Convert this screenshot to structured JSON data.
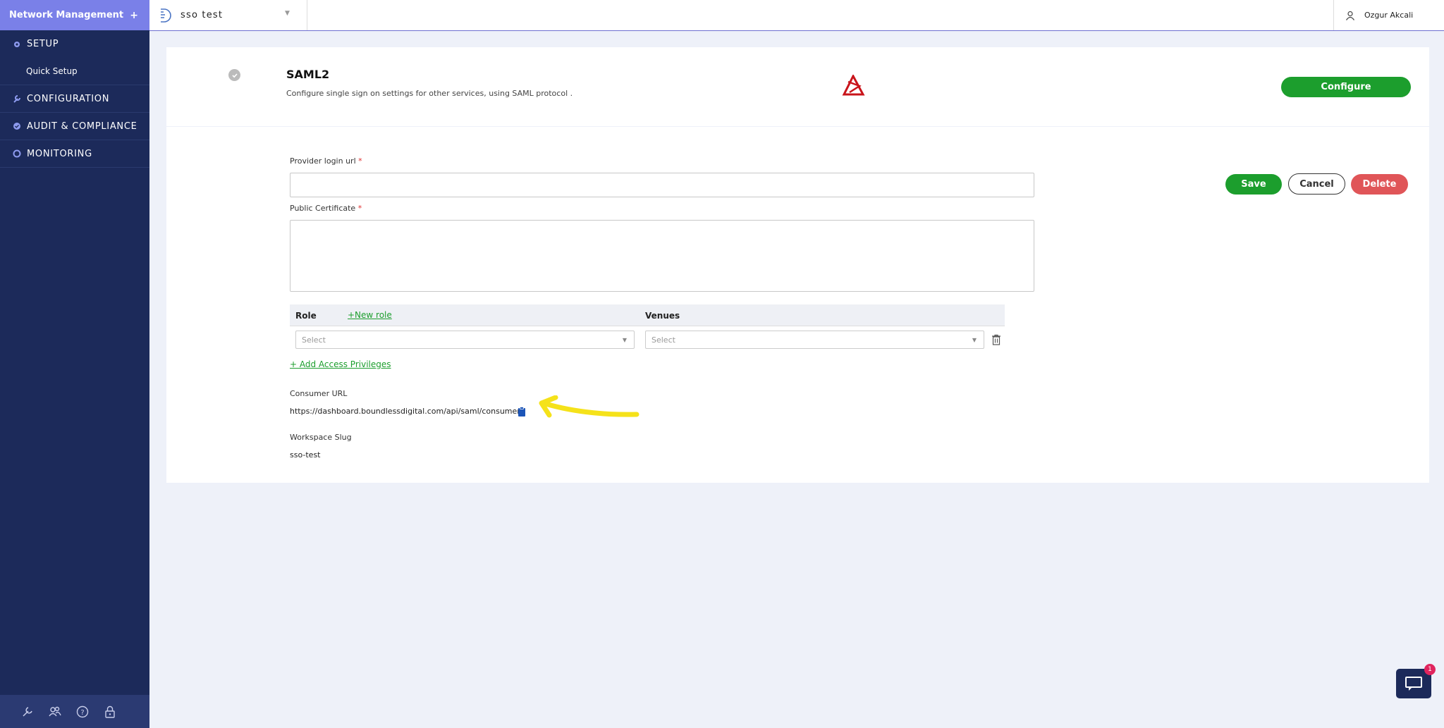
{
  "sidebar": {
    "title": "Network Management",
    "add_label": "+",
    "items": [
      {
        "label": "SETUP"
      },
      {
        "label": "Quick Setup"
      },
      {
        "label": "CONFIGURATION"
      },
      {
        "label": "AUDIT & COMPLIANCE"
      },
      {
        "label": "MONITORING"
      }
    ],
    "footer_icons": [
      "wrench-icon",
      "users-icon",
      "help-icon",
      "lock-icon"
    ]
  },
  "topbar": {
    "workspace_name": "sso test",
    "user_name": "Ozgur Akcali"
  },
  "saml": {
    "title": "SAML2",
    "description": "Configure single sign on settings for other services, using SAML protocol .",
    "configure_label": "Configure"
  },
  "form": {
    "provider_login_url_label": "Provider login url",
    "provider_login_url_value": "",
    "public_certificate_label": "Public Certificate",
    "public_certificate_value": "",
    "required_mark": "*",
    "save_label": "Save",
    "cancel_label": "Cancel",
    "delete_label": "Delete"
  },
  "access": {
    "role_header": "Role",
    "new_role_label": "+New role",
    "venues_header": "Venues",
    "role_placeholder": "Select",
    "venues_placeholder": "Select",
    "add_privileges_label": "+ Add Access Privileges"
  },
  "consumer": {
    "label": "Consumer URL",
    "value": "https://dashboard.boundlessdigital.com/api/saml/consumer/"
  },
  "workspace_slug": {
    "label": "Workspace Slug",
    "value": "sso-test"
  },
  "chat": {
    "badge_count": "1"
  },
  "colors": {
    "sidebar_bg": "#1c2a5a",
    "sidebar_header": "#7a80e8",
    "primary_green": "#1c9e2d",
    "danger_red": "#e05558",
    "annotation_yellow": "#f5e21a"
  }
}
